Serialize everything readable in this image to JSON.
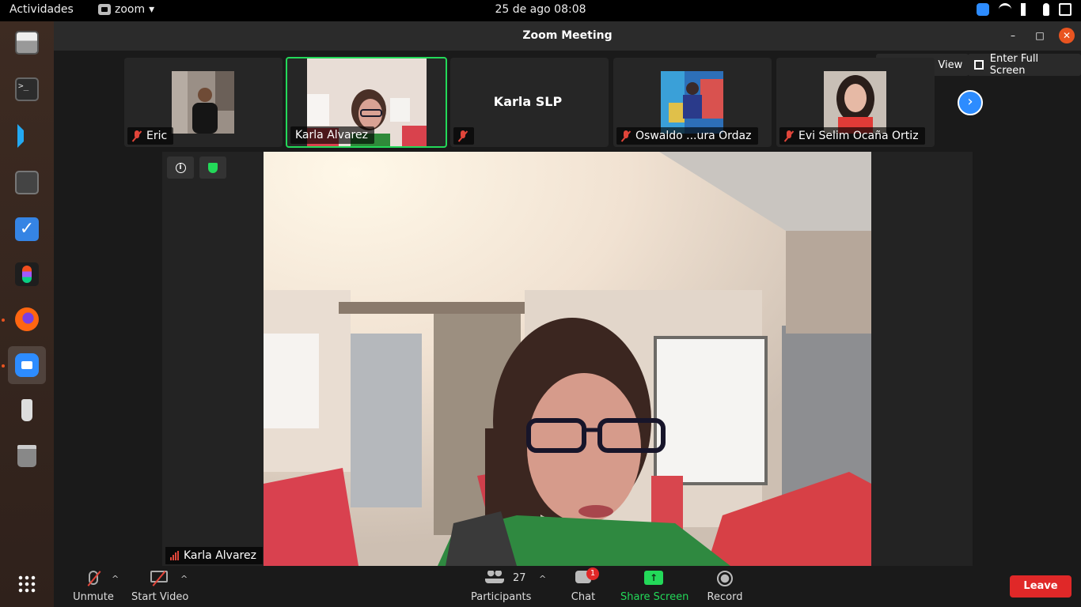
{
  "topbar": {
    "activities": "Actividades",
    "app_name": "zoom",
    "app_menu_arrow": "▾",
    "clock": "25 de ago  08:08"
  },
  "window": {
    "title": "Zoom Meeting",
    "minimize": "–",
    "maximize": "□",
    "close": "✕"
  },
  "view_controls": {
    "gallery_view": "Gallery View",
    "full_screen": "Enter Full Screen"
  },
  "participants_strip": [
    {
      "name": "Eric",
      "muted": true
    },
    {
      "name": "Karla Alvarez",
      "muted": false,
      "speaking": true
    },
    {
      "name": "Karla SLP",
      "muted": true,
      "video": false
    },
    {
      "name": "Oswaldo ...ura Ordaz",
      "muted": true
    },
    {
      "name": "Evi Selim Ocaña Ortiz",
      "muted": true
    }
  ],
  "next_page": "›",
  "main_video": {
    "speaker_name": "Karla Alvarez",
    "info_glyph": "i"
  },
  "toolbar": {
    "unmute": "Unmute",
    "start_video": "Start Video",
    "participants": "Participants",
    "participants_count": "27",
    "chat": "Chat",
    "chat_badge": "1",
    "share_screen": "Share Screen",
    "share_glyph": "↑",
    "record": "Record",
    "leave": "Leave",
    "caret": "^"
  },
  "colors": {
    "speaking_border": "#23d959",
    "zoom_blue": "#2d8cff",
    "leave_red": "#e02828",
    "share_green": "#23d959"
  }
}
